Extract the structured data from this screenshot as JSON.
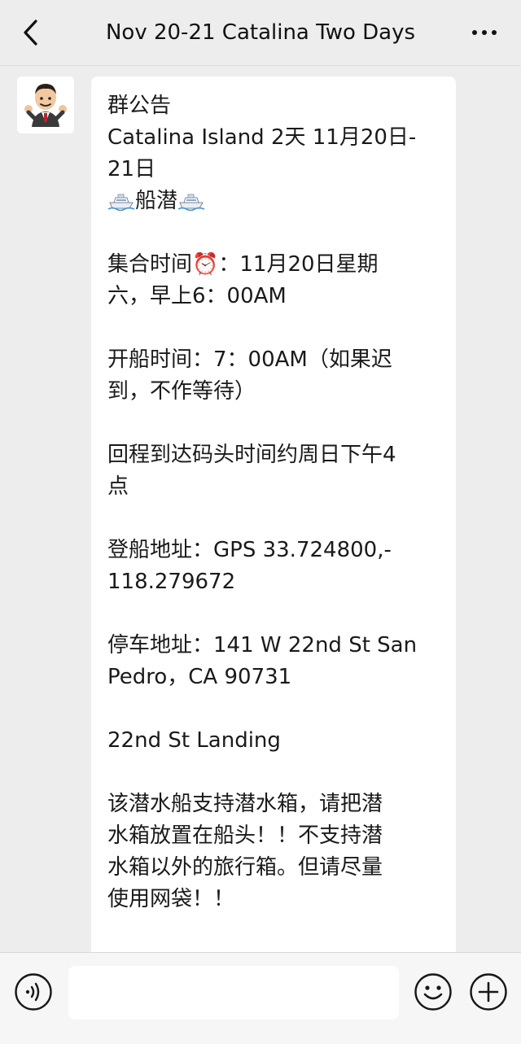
{
  "header": {
    "title": "Nov 20-21 Catalina Two Days",
    "back_icon": "chevron-left-icon",
    "more_icon": "more-dots-icon"
  },
  "message": {
    "avatar_icon": "cartoon-man-avatar",
    "lines": {
      "l1": "群公告",
      "l2": "Catalina Island 2天 11月20日-",
      "l3": "21日",
      "l4_text": "船潜",
      "l5": "集合时间⏰：11月20日星期",
      "l6": "六，早上6：00AM",
      "l7": "开船时间：7：00AM（如果迟",
      "l8": "到，不作等待）",
      "l9": "回程到达码头时间约周日下午4",
      "l10": "点",
      "l11": "登船地址：GPS  33.724800,-",
      "l12": "118.279672",
      "l13": "停车地址：141 W 22nd St San",
      "l14": "Pedro，CA 90731",
      "l15": "22nd St Landing",
      "l16": "该潜水船支持潜水箱，请把潜",
      "l17": "水箱放置在船头！！不支持潜",
      "l18": "水箱以外的旅行箱。但请尽量",
      "l19": "使用网袋！！"
    },
    "boat_emoji_icon": "ship-icon"
  },
  "input_bar": {
    "voice_icon": "voice-icon",
    "input_value": "",
    "emoji_icon": "smiley-icon",
    "plus_icon": "plus-circle-icon"
  }
}
